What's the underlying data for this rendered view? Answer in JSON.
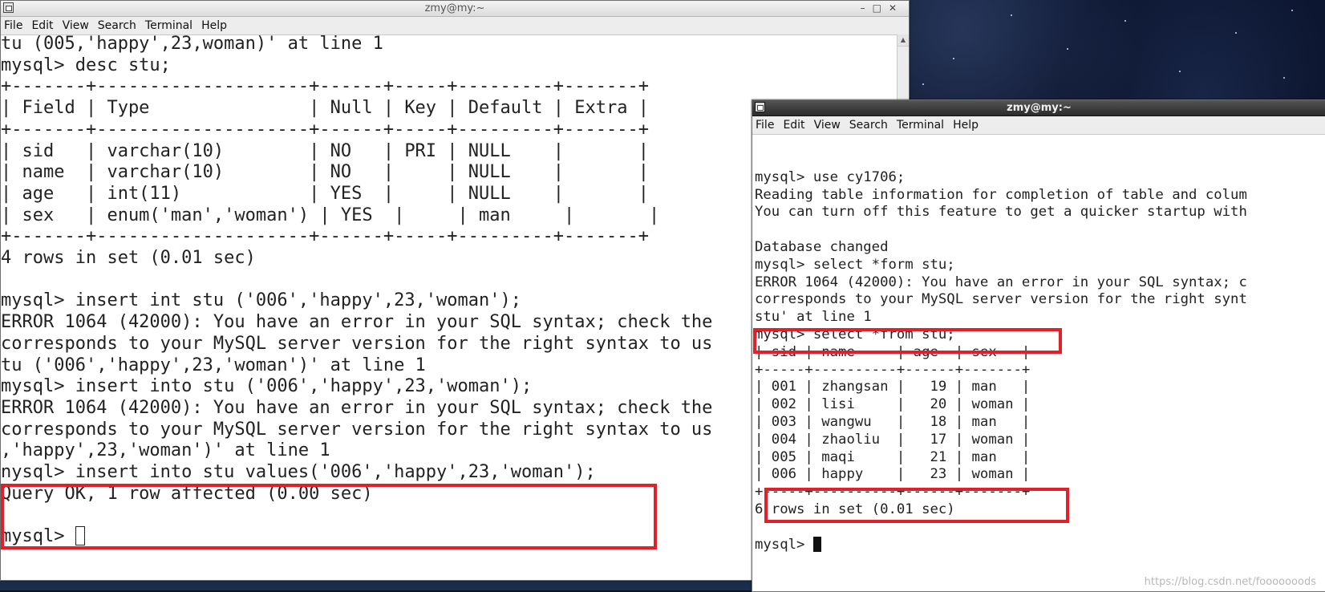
{
  "window1": {
    "title": "zmy@my:~",
    "menu": [
      "File",
      "Edit",
      "View",
      "Search",
      "Terminal",
      "Help"
    ],
    "lines": [
      "tu (005,'happy',23,woman)' at line 1",
      "mysql> desc stu;",
      "+-------+--------------------+------+-----+---------+-------+",
      "| Field | Type               | Null | Key | Default | Extra |",
      "+-------+--------------------+------+-----+---------+-------+",
      "| sid   | varchar(10)        | NO   | PRI | NULL    |       |",
      "| name  | varchar(10)        | NO   |     | NULL    |       |",
      "| age   | int(11)            | YES  |     | NULL    |       |",
      "| sex   | enum('man','woman') | YES  |     | man     |       |",
      "+-------+--------------------+------+-----+---------+-------+",
      "4 rows in set (0.01 sec)",
      "",
      "mysql> insert int stu ('006','happy',23,'woman');",
      "ERROR 1064 (42000): You have an error in your SQL syntax; check the",
      "corresponds to your MySQL server version for the right syntax to us",
      "tu ('006','happy',23,'woman')' at line 1",
      "mysql> insert into stu ('006','happy',23,'woman');",
      "ERROR 1064 (42000): You have an error in your SQL syntax; check the",
      "corresponds to your MySQL server version for the right syntax to us",
      ",'happy',23,'woman')' at line 1",
      "nysql> insert into stu values('006','happy',23,'woman');",
      "Query OK, 1 row affected (0.00 sec)",
      ""
    ],
    "prompt": "mysql> "
  },
  "window2": {
    "title": "zmy@my:~",
    "menu": [
      "File",
      "Edit",
      "View",
      "Search",
      "Terminal",
      "Help"
    ],
    "lines": [
      "",
      "mysql> use cy1706;",
      "Reading table information for completion of table and colum",
      "You can turn off this feature to get a quicker startup with",
      "",
      "Database changed",
      "mysql> select *form stu;",
      "ERROR 1064 (42000): You have an error in your SQL syntax; c",
      "corresponds to your MySQL server version for the right synt",
      "stu' at line 1",
      "mysql> select *from stu;",
      "| sid | name     | age  | sex   |",
      "+-----+----------+------+-------+",
      "| 001 | zhangsan |   19 | man   |",
      "| 002 | lisi     |   20 | woman |",
      "| 003 | wangwu   |   18 | man   |",
      "| 004 | zhaoliu  |   17 | woman |",
      "| 005 | maqi     |   21 | man   |",
      "| 006 | happy    |   23 | woman |",
      "+-----+----------+------+-------+",
      "6 rows in set (0.01 sec)",
      ""
    ],
    "prompt": "mysql> "
  },
  "watermark": "https://blog.csdn.net/fooooooods"
}
